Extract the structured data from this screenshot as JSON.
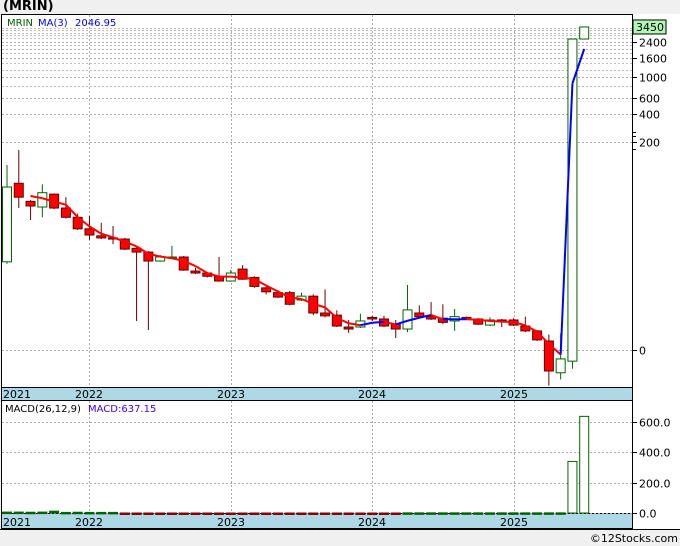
{
  "header": {
    "title": "(MRIN)"
  },
  "footer": {
    "copyright": "©12Stocks.com"
  },
  "colors": {
    "up": "#006400",
    "down": "#ff0000",
    "down_wick": "#660000",
    "ma_rising": "#0000ff",
    "ma_falling": "#ff0000",
    "date_band": "#add8e6",
    "last_price_badge": "#b3f5b3"
  },
  "chart_data": [
    {
      "type": "candlestick",
      "panel": "price",
      "legend": {
        "symbol": "MRIN",
        "ma_label": "MA(3)",
        "ma_value": "2046.95"
      },
      "y_scale": "log",
      "y_ticks": [
        {
          "value": 2400,
          "label": "2400"
        },
        {
          "value": 1600,
          "label": "1600"
        },
        {
          "value": 1000,
          "label": "1000"
        },
        {
          "value": 600,
          "label": "600"
        },
        {
          "value": 400,
          "label": "400"
        },
        {
          "value": 200,
          "label": "200"
        },
        {
          "value": 1.16,
          "label": "0"
        }
      ],
      "last_price_label": "3450",
      "x_labels": [
        "2021",
        "2022",
        "2023",
        "2024",
        "2025"
      ],
      "grid": true,
      "ohlc": [
        [
          10.3,
          113,
          9.8,
          65.6
        ],
        [
          72,
          164,
          39,
          51
        ],
        [
          46,
          47.5,
          29,
          41
        ],
        [
          40,
          70,
          31,
          57
        ],
        [
          55,
          56,
          38,
          39
        ],
        [
          39,
          51,
          30,
          31
        ],
        [
          31,
          34,
          22.6,
          23.3
        ],
        [
          23.3,
          32,
          17.7,
          20
        ],
        [
          19.6,
          27,
          18.1,
          18.6
        ],
        [
          18.6,
          25,
          16,
          18.1
        ],
        [
          18.1,
          18.6,
          13.8,
          14.1
        ],
        [
          14.4,
          14.8,
          2.38,
          13.1
        ],
        [
          13.1,
          13.4,
          1.9,
          10.5
        ],
        [
          10.5,
          12.2,
          10.3,
          11.6
        ],
        [
          11.3,
          15.3,
          11,
          11.6
        ],
        [
          11.6,
          11.9,
          8.2,
          8.4
        ],
        [
          8.2,
          8.9,
          7.6,
          7.8
        ],
        [
          7.8,
          8,
          7.0,
          7.2
        ],
        [
          7.2,
          11.6,
          6.3,
          6.4
        ],
        [
          6.4,
          8.4,
          6.3,
          7.8
        ],
        [
          8.6,
          9.5,
          6.6,
          6.7
        ],
        [
          7.0,
          7.2,
          5.4,
          5.6
        ],
        [
          5.4,
          5.6,
          4.6,
          4.9
        ],
        [
          4.8,
          5.1,
          4.2,
          4.3
        ],
        [
          4.8,
          5.0,
          3.5,
          3.6
        ],
        [
          4.0,
          4.8,
          3.9,
          4.4
        ],
        [
          4.4,
          4.6,
          2.75,
          2.9
        ],
        [
          2.9,
          5.2,
          2.6,
          2.7
        ],
        [
          2.75,
          3.1,
          2.05,
          2.1
        ],
        [
          2.05,
          2.44,
          1.77,
          1.95
        ],
        [
          2.05,
          2.85,
          2.0,
          2.38
        ],
        [
          2.6,
          2.7,
          2.38,
          2.5
        ],
        [
          2.5,
          2.7,
          2.05,
          2.1
        ],
        [
          2.2,
          2.44,
          1.56,
          1.95
        ],
        [
          1.95,
          5.8,
          1.81,
          3.13
        ],
        [
          2.9,
          3.5,
          2.55,
          2.65
        ],
        [
          2.65,
          3.8,
          2.44,
          2.5
        ],
        [
          2.55,
          3.6,
          2.2,
          2.3
        ],
        [
          2.38,
          3.2,
          1.86,
          2.65
        ],
        [
          2.6,
          2.65,
          2.44,
          2.5
        ],
        [
          2.5,
          2.55,
          2.15,
          2.2
        ],
        [
          2.15,
          2.6,
          2.1,
          2.44
        ],
        [
          2.44,
          2.5,
          2.05,
          2.38
        ],
        [
          2.44,
          2.55,
          2.1,
          2.15
        ],
        [
          2.1,
          2.65,
          1.81,
          1.86
        ],
        [
          1.86,
          1.9,
          1.45,
          1.49
        ],
        [
          1.45,
          1.7,
          0.48,
          0.69
        ],
        [
          0.66,
          1.75,
          0.56,
          0.93
        ],
        [
          0.88,
          2560,
          0.73,
          2560
        ],
        [
          2560,
          3450,
          2560,
          3450
        ]
      ]
    },
    {
      "type": "bar",
      "panel": "macd",
      "legend": {
        "label": "MACD(26,12,9)",
        "value_label": "MACD:637.15"
      },
      "y_ticks": [
        {
          "value": 600,
          "label": "600.0"
        },
        {
          "value": 400,
          "label": "400.0"
        },
        {
          "value": 200,
          "label": "200.0"
        },
        {
          "value": 0,
          "label": "0.0"
        }
      ],
      "ylim": [
        -30,
        690
      ],
      "x_labels": [
        "2021",
        "2022",
        "2023",
        "2024",
        "2025"
      ],
      "grid": true,
      "values": [
        6,
        6,
        5,
        6,
        12,
        4,
        5,
        4,
        4,
        4,
        -2,
        -2,
        -2,
        -2,
        -2,
        -2,
        -2,
        -2,
        -2,
        -2,
        -2,
        -2,
        -2,
        -2,
        -2,
        -2,
        -2,
        -2,
        -2,
        -2,
        -2,
        -2,
        -1,
        -1,
        1,
        1,
        1,
        1,
        1,
        1,
        1,
        1,
        1,
        1,
        1,
        1,
        1,
        1,
        340,
        637.15
      ]
    }
  ]
}
